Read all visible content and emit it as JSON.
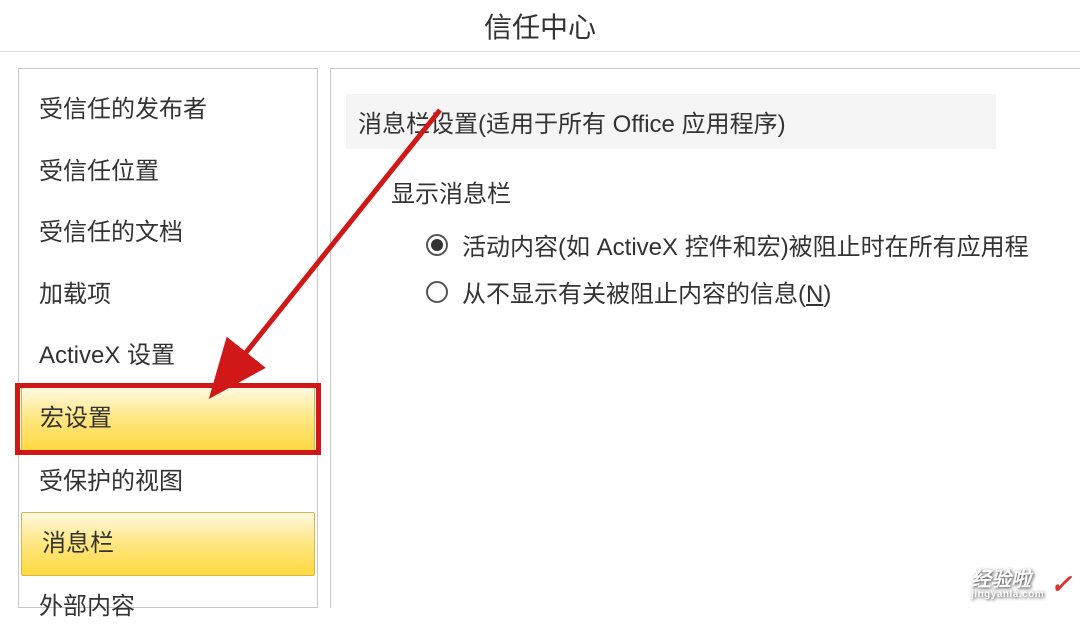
{
  "header": {
    "title": "信任中心"
  },
  "sidebar": {
    "items": [
      {
        "label": "受信任的发布者"
      },
      {
        "label": "受信任位置"
      },
      {
        "label": "受信任的文档"
      },
      {
        "label": "加载项"
      },
      {
        "label": "ActiveX 设置"
      },
      {
        "label": "宏设置"
      },
      {
        "label": "受保护的视图"
      },
      {
        "label": "消息栏"
      },
      {
        "label": "外部内容"
      }
    ]
  },
  "content": {
    "section_title": "消息栏设置(适用于所有 Office 应用程序)",
    "subsection_label": "显示消息栏",
    "radios": [
      {
        "label": "活动内容(如 ActiveX 控件和宏)被阻止时在所有应用程",
        "selected": true
      },
      {
        "label_prefix": "从不显示有关被阻止内容的信息(",
        "label_underline": "N",
        "label_suffix": ")",
        "selected": false
      }
    ]
  },
  "watermark": {
    "main": "经验啦",
    "sub": "jingyanla.com"
  },
  "annotation": {
    "highlighted_item": "宏设置"
  }
}
